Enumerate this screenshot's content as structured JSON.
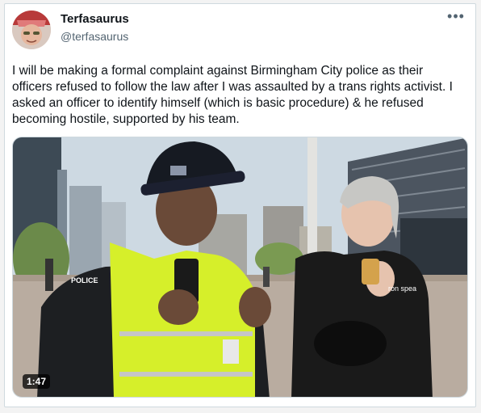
{
  "author": {
    "display_name": "Terfasaurus",
    "handle": "@terfasaurus"
  },
  "tweet": {
    "text": "I will be making a formal complaint against Birmingham City police as their officers refused to follow the law after I was assaulted by a trans rights activist. I asked an officer to identify himself (which is basic procedure) & he refused becoming hostile, supported by his team."
  },
  "media": {
    "duration": "1:47",
    "vest_label": "POLICE",
    "shirt_text": "ron\nspea"
  },
  "icons": {
    "more": "more-horizontal-icon"
  }
}
